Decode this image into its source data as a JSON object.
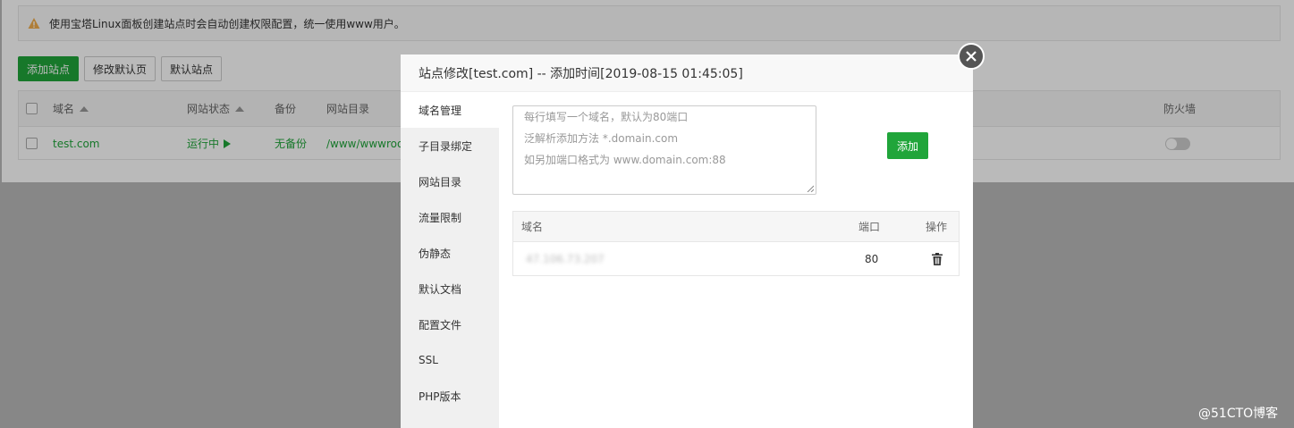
{
  "notice": {
    "text": "使用宝塔Linux面板创建站点时会自动创建权限配置，统一使用www用户。"
  },
  "toolbar": {
    "add_site": "添加站点",
    "modify_default_page": "修改默认页",
    "default_site": "默认站点"
  },
  "site_table": {
    "headers": {
      "domain": "域名",
      "status": "网站状态",
      "backup": "备份",
      "dir": "网站目录",
      "firewall": "防火墙"
    },
    "row": {
      "domain": "test.com",
      "status": "运行中",
      "backup": "无备份",
      "dir": "/www/wwwroo"
    }
  },
  "modal": {
    "title": "站点修改[test.com] -- 添加时间[2019-08-15 01:45:05]",
    "menu": [
      "域名管理",
      "子目录绑定",
      "网站目录",
      "流量限制",
      "伪静态",
      "默认文档",
      "配置文件",
      "SSL",
      "PHP版本"
    ],
    "placeholder_lines": [
      "每行填写一个域名，默认为80端口",
      "泛解析添加方法 *.domain.com",
      "如另加端口格式为 www.domain.com:88"
    ],
    "add_button": "添加",
    "domain_table": {
      "headers": {
        "domain": "域名",
        "port": "端口",
        "action": "操作"
      },
      "rows": [
        {
          "domain": "47.106.73.207",
          "port": "80"
        }
      ]
    }
  },
  "watermark": "@51CTO博客",
  "colors": {
    "accent": "#20a53a"
  }
}
